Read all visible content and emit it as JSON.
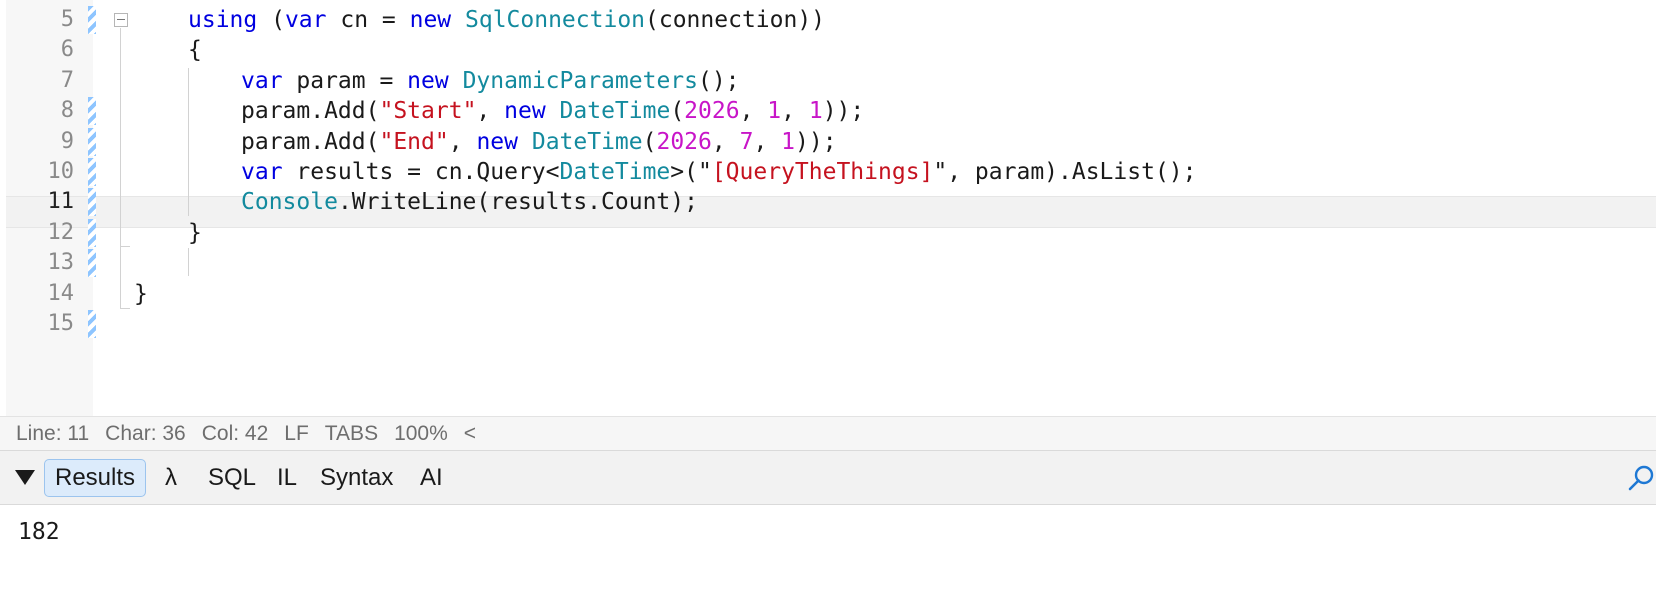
{
  "editor": {
    "current_line": "11",
    "line_numbers": [
      "5",
      "6",
      "7",
      "8",
      "9",
      "10",
      "11",
      "12",
      "13",
      "14",
      "15"
    ],
    "code_lines": [
      [
        {
          "t": "using",
          "c": "kw"
        },
        {
          "t": " ("
        },
        {
          "t": "var",
          "c": "kw"
        },
        {
          "t": " cn = "
        },
        {
          "t": "new",
          "c": "kw"
        },
        {
          "t": " "
        },
        {
          "t": "SqlConnection",
          "c": "ty"
        },
        {
          "t": "(connection))"
        }
      ],
      [
        {
          "t": "{"
        }
      ],
      [
        {
          "t": "var",
          "c": "kw"
        },
        {
          "t": " param = "
        },
        {
          "t": "new",
          "c": "kw"
        },
        {
          "t": " "
        },
        {
          "t": "DynamicParameters",
          "c": "ty"
        },
        {
          "t": "();"
        }
      ],
      [
        {
          "t": "param.Add("
        },
        {
          "t": "\"Start\"",
          "c": "str"
        },
        {
          "t": ", "
        },
        {
          "t": "new",
          "c": "kw"
        },
        {
          "t": " "
        },
        {
          "t": "DateTime",
          "c": "ty"
        },
        {
          "t": "("
        },
        {
          "t": "2026",
          "c": "num"
        },
        {
          "t": ", "
        },
        {
          "t": "1",
          "c": "num"
        },
        {
          "t": ", "
        },
        {
          "t": "1",
          "c": "num"
        },
        {
          "t": "));"
        }
      ],
      [
        {
          "t": "param.Add("
        },
        {
          "t": "\"End\"",
          "c": "str"
        },
        {
          "t": ", "
        },
        {
          "t": "new",
          "c": "kw"
        },
        {
          "t": " "
        },
        {
          "t": "DateTime",
          "c": "ty"
        },
        {
          "t": "("
        },
        {
          "t": "2026",
          "c": "num"
        },
        {
          "t": ", "
        },
        {
          "t": "7",
          "c": "num"
        },
        {
          "t": ", "
        },
        {
          "t": "1",
          "c": "num"
        },
        {
          "t": "));"
        }
      ],
      [
        {
          "t": "var",
          "c": "kw"
        },
        {
          "t": " results = cn.Query<"
        },
        {
          "t": "DateTime",
          "c": "ty"
        },
        {
          "t": ">(\""
        },
        {
          "t": "[QueryTheThings]",
          "c": "str"
        },
        {
          "t": "\", param).AsList();"
        }
      ],
      [
        {
          "t": "Console",
          "c": "ty"
        },
        {
          "t": ".WriteLine(results.Count);"
        }
      ],
      [
        {
          "t": "}"
        }
      ],
      [],
      [
        {
          "t": "}"
        }
      ],
      []
    ]
  },
  "status_bar": {
    "line": "Line: 11",
    "char": "Char: 36",
    "col": "Col: 42",
    "line_ending": "LF",
    "indent": "TABS",
    "zoom": "100%",
    "collapse_glyph": "<"
  },
  "results_panel": {
    "tabs": [
      "Results",
      "λ",
      "SQL",
      "IL",
      "Syntax",
      "AI"
    ],
    "active_tab": "Results",
    "output": "182"
  },
  "icons": {
    "toggle": "triangle-down-icon",
    "search": "search-icon",
    "fold": "fold-collapse-icon"
  },
  "colors": {
    "keyword": "#0000e0",
    "type": "#138a9e",
    "string": "#c5121f",
    "number": "#c815c8",
    "active_tab_bg": "#dcebfb",
    "search_icon": "#1e78d4"
  }
}
